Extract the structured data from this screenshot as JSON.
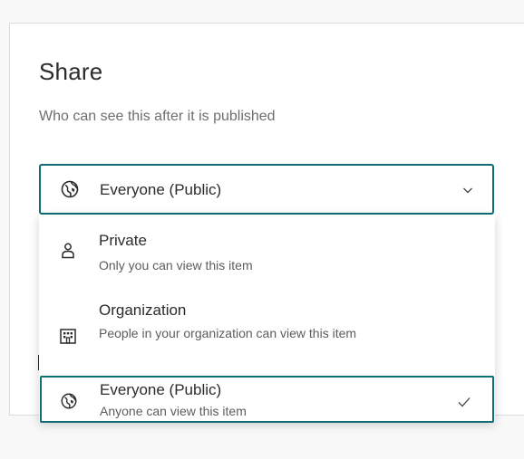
{
  "dialog": {
    "title": "Share",
    "subtitle": "Who can see this after it is published"
  },
  "select": {
    "selected_label": "Everyone (Public)",
    "selected_icon": "globe-icon",
    "chevron_icon": "chevron-down-icon"
  },
  "options": [
    {
      "title": "Private",
      "description": "Only you can view this item",
      "icon": "person-icon",
      "selected": false
    },
    {
      "title": "Organization",
      "description": "People in your organization can view this item",
      "icon": "building-icon",
      "selected": false
    },
    {
      "title": "Everyone (Public)",
      "description": "Anyone can view this item",
      "icon": "globe-icon",
      "selected": true
    }
  ],
  "colors": {
    "accent": "#0f6e74",
    "text": "#2b2b2b",
    "muted_text": "#6e6e6e",
    "panel_border": "#dcdcdc"
  }
}
